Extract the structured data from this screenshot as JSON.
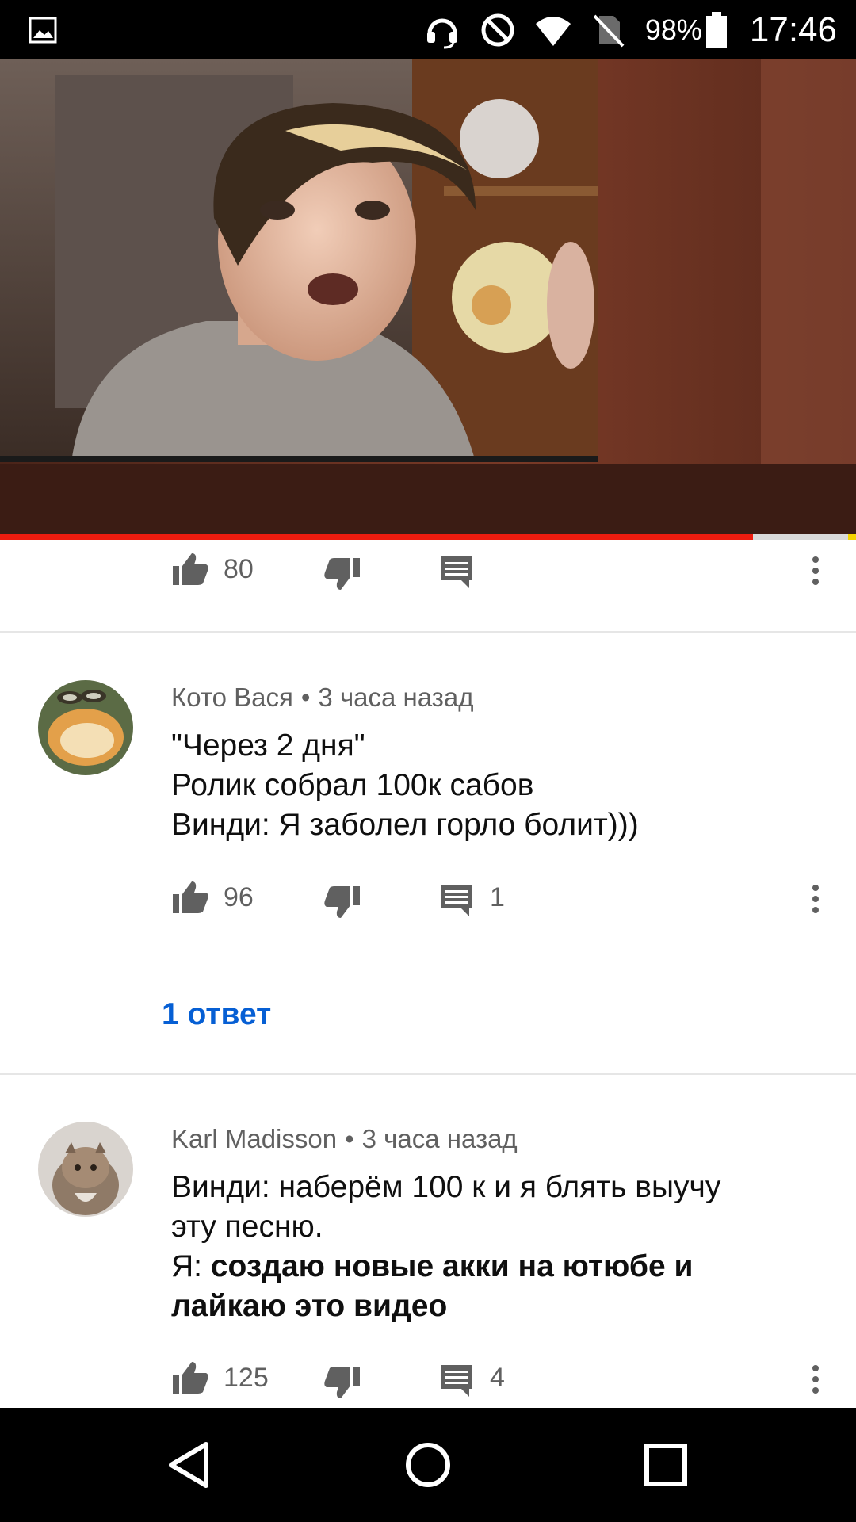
{
  "status_bar": {
    "battery": "98%",
    "time": "17:46",
    "icons": [
      "image-notification-icon",
      "headset-icon",
      "do-not-disturb-icon",
      "wifi-icon",
      "no-sim-icon",
      "battery-icon"
    ]
  },
  "video": {
    "progress_fraction": 0.88
  },
  "comments": [
    {
      "author": "",
      "time": "",
      "body_lines": [],
      "likes": "80",
      "replies": ""
    },
    {
      "author": "Кото Вася",
      "time": "3 часа назад",
      "body_lines": [
        "\"Через 2 дня\"",
        "Ролик собрал 100к сабов",
        "Винди: Я заболел горло болит)))"
      ],
      "likes": "96",
      "replies": "1",
      "replies_link": "1 ответ"
    },
    {
      "author": "Karl Madisson",
      "time": "3 часа назад",
      "body_line_1": "Винди: наберём 100 к и я блять выучу",
      "body_line_2": "эту песню.",
      "body_line_3_prefix": "Я: ",
      "body_line_3_bold": "создаю новые акки на ютюбе и",
      "body_line_4_bold": "лайкаю это видео",
      "likes": "125",
      "replies": "4"
    }
  ],
  "separator": "•",
  "colors": {
    "accent_link": "#065fd4",
    "progress": "#ee1c0f",
    "meta_text": "#606060"
  }
}
